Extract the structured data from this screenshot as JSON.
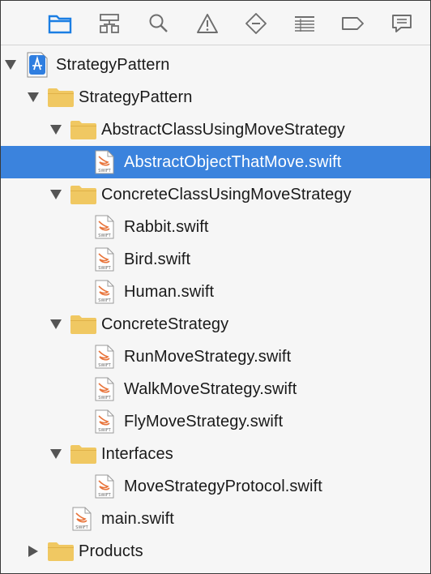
{
  "toolbar": {
    "icons": [
      {
        "name": "project-navigator-icon",
        "color": "#1b7ee3"
      },
      {
        "name": "symbol-navigator-icon",
        "color": "#6e6e6e"
      },
      {
        "name": "find-navigator-icon",
        "color": "#6e6e6e"
      },
      {
        "name": "issue-navigator-icon",
        "color": "#6e6e6e"
      },
      {
        "name": "test-navigator-icon",
        "color": "#6e6e6e"
      },
      {
        "name": "debug-navigator-icon",
        "color": "#6e6e6e"
      },
      {
        "name": "breakpoint-navigator-icon",
        "color": "#6e6e6e"
      },
      {
        "name": "report-navigator-icon",
        "color": "#6e6e6e"
      }
    ]
  },
  "tree": {
    "project": "StrategyPattern",
    "group_main": "StrategyPattern",
    "folder_abstract": "AbstractClassUsingMoveStrategy",
    "file_abstract": "AbstractObjectThatMove.swift",
    "folder_concrete_class": "ConcreteClassUsingMoveStrategy",
    "file_rabbit": "Rabbit.swift",
    "file_bird": "Bird.swift",
    "file_human": "Human.swift",
    "folder_concrete_strategy": "ConcreteStrategy",
    "file_run": "RunMoveStrategy.swift",
    "file_walk": "WalkMoveStrategy.swift",
    "file_fly": "FlyMoveStrategy.swift",
    "folder_interfaces": "Interfaces",
    "file_protocol": "MoveStrategyProtocol.swift",
    "file_main": "main.swift",
    "folder_products": "Products",
    "file_icon_caption": "SWIFT"
  },
  "colors": {
    "selection": "#3b83dd",
    "folder": "#f0c862",
    "accent": "#1b7ee3"
  }
}
